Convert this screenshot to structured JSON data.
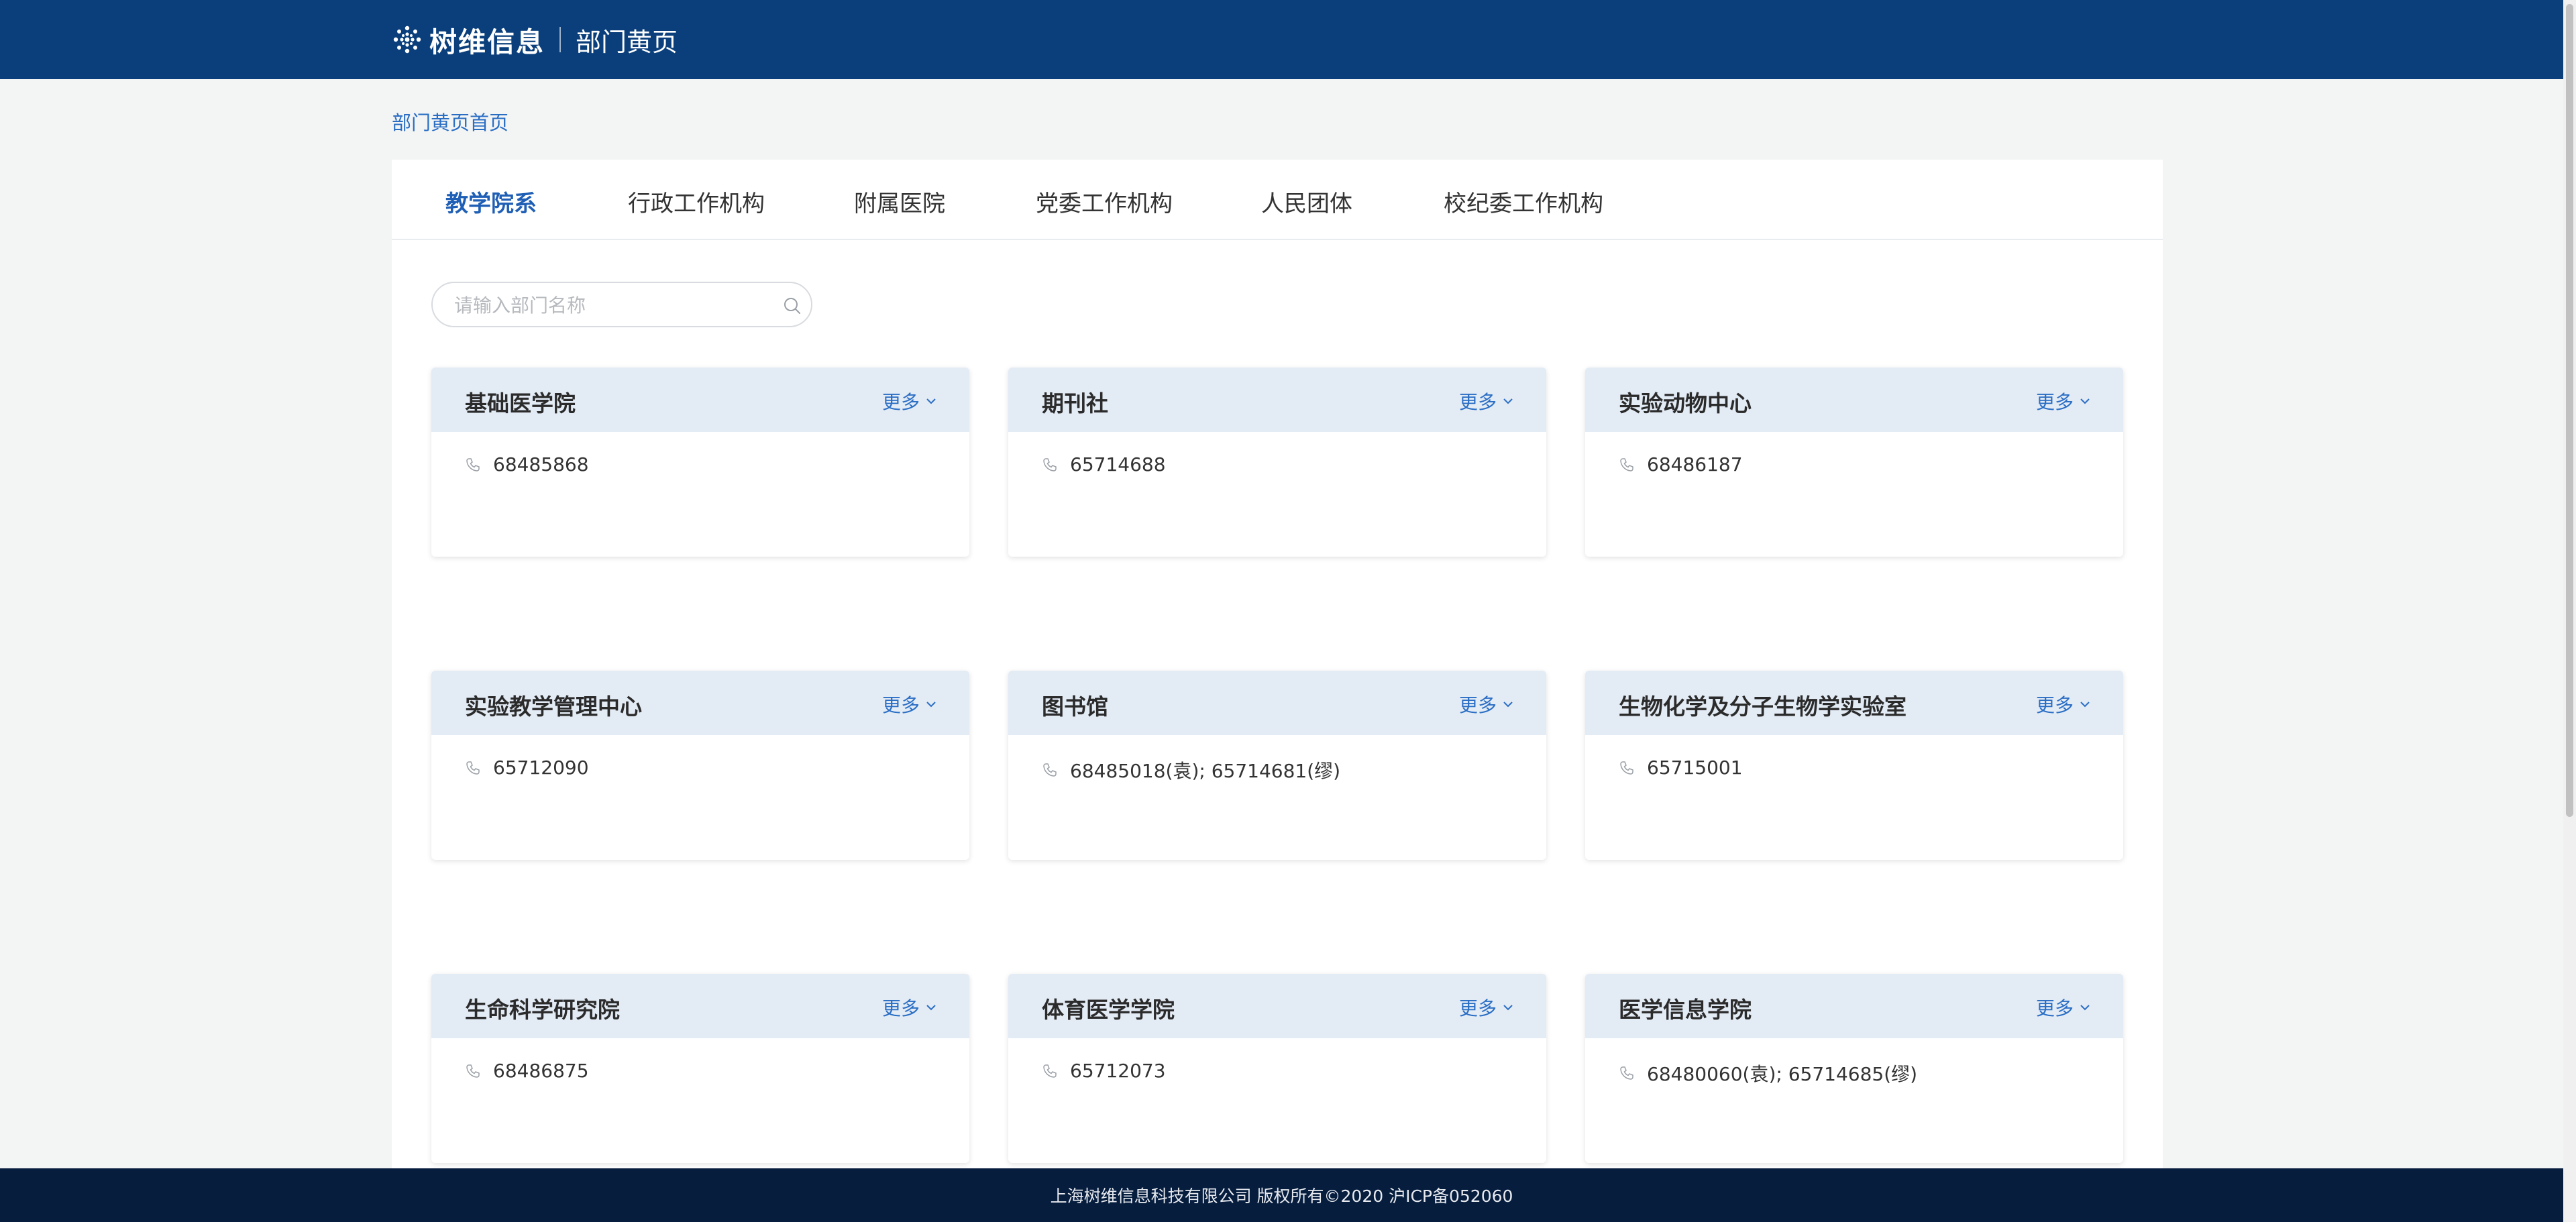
{
  "header": {
    "logo_text": "树维信息",
    "subtitle": "部门黄页"
  },
  "breadcrumb": "部门黄页首页",
  "tabs": [
    {
      "label": "教学院系",
      "active": true
    },
    {
      "label": "行政工作机构",
      "active": false
    },
    {
      "label": "附属医院",
      "active": false
    },
    {
      "label": "党委工作机构",
      "active": false
    },
    {
      "label": "人民团体",
      "active": false
    },
    {
      "label": "校纪委工作机构",
      "active": false
    }
  ],
  "search": {
    "placeholder": "请输入部门名称",
    "value": ""
  },
  "more_label": "更多",
  "departments": [
    {
      "name": "基础医学院",
      "phone": "68485868"
    },
    {
      "name": "期刊社",
      "phone": "65714688"
    },
    {
      "name": "实验动物中心",
      "phone": "68486187"
    },
    {
      "name": "实验教学管理中心",
      "phone": "65712090"
    },
    {
      "name": "图书馆",
      "phone": "68485018(袁); 65714681(缪)"
    },
    {
      "name": "生物化学及分子生物学实验室",
      "phone": "65715001"
    },
    {
      "name": "生命科学研究院",
      "phone": "68486875"
    },
    {
      "name": "体育医学学院",
      "phone": "65712073"
    },
    {
      "name": "医学信息学院",
      "phone": "68480060(袁); 65714685(缪)"
    }
  ],
  "footer": "上海树维信息科技有限公司 版权所有©2020 沪ICP备052060",
  "colors": {
    "header_bg": "#0a3f7b",
    "footer_bg": "#061d3e",
    "accent": "#2a6ec4",
    "card_header_bg": "#e3ebf5"
  }
}
